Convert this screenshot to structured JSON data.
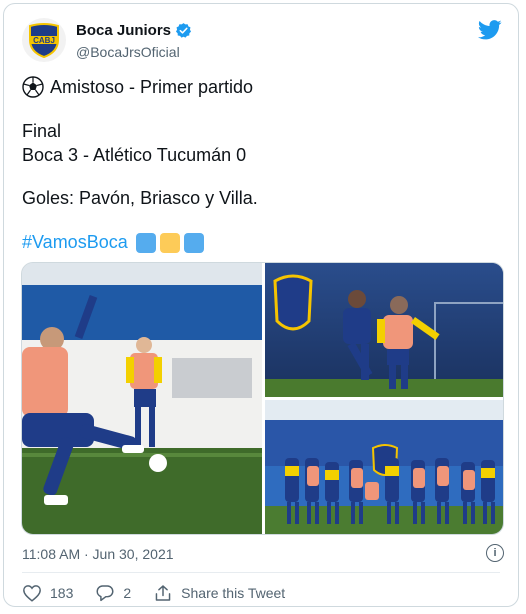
{
  "author": {
    "name": "Boca Juniors",
    "handle": "@BocaJrsOficial",
    "crest_text": "CABJ"
  },
  "tweet": {
    "line1": "Amistoso - Primer partido",
    "line2": "Final",
    "line3": "Boca 3 - Atlético Tucumán 0",
    "line4": "Goles: Pavón, Briasco y Villa.",
    "hashtag": "#VamosBoca"
  },
  "emoji_squares": [
    "#55acee",
    "#fdcb58",
    "#55acee"
  ],
  "timestamp": "11:08 AM · Jun 30, 2021",
  "actions": {
    "likes": "183",
    "replies": "2",
    "share_label": "Share this Tweet"
  },
  "colors": {
    "accent": "#1d9bf0",
    "boca_blue": "#1f3c88",
    "boca_yellow": "#f5c400"
  }
}
